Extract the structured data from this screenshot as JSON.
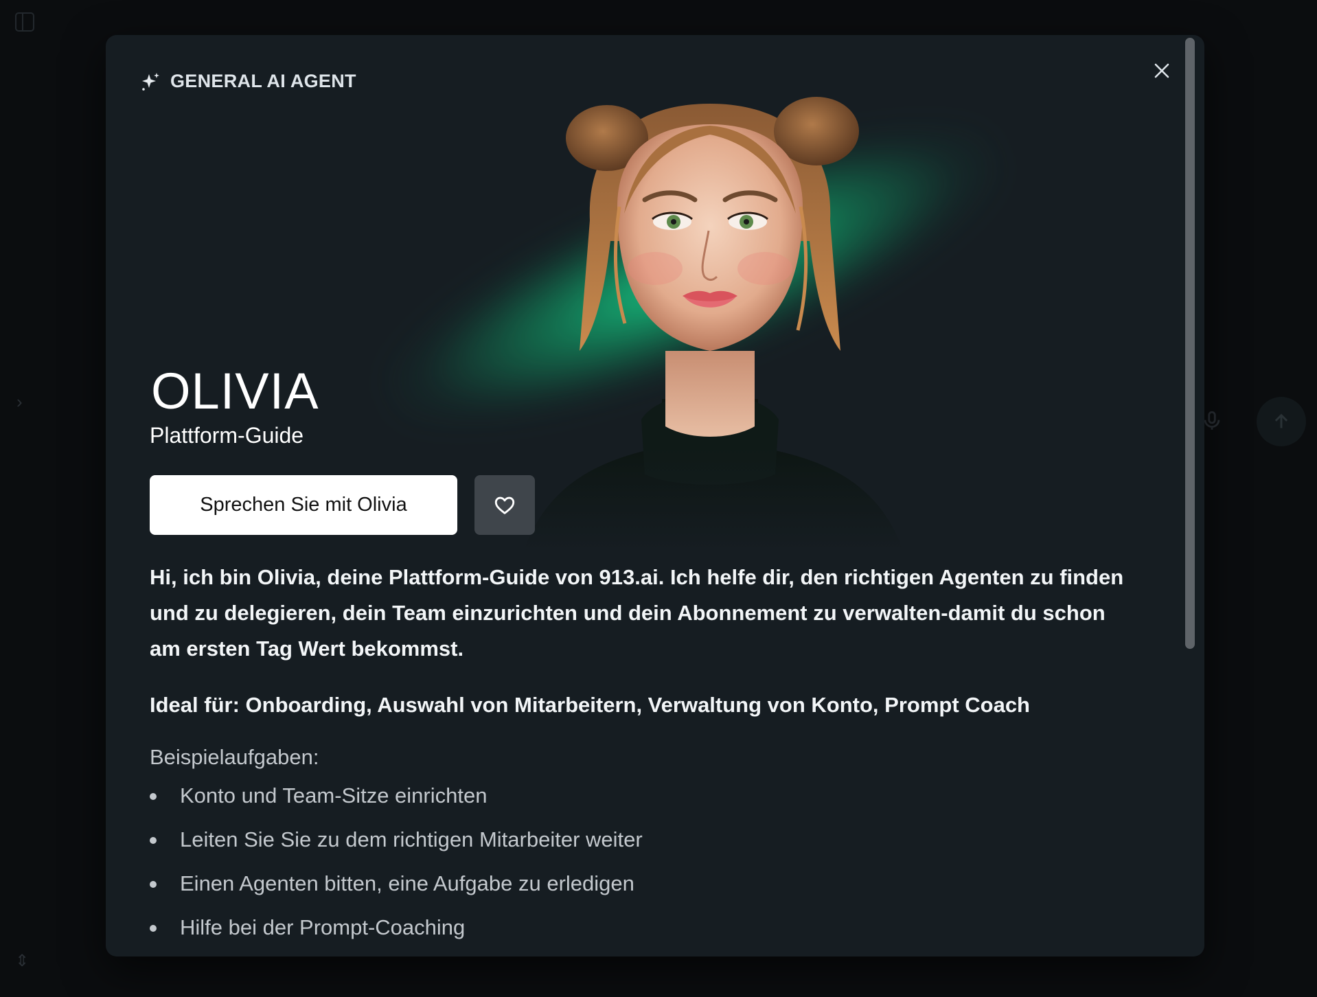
{
  "modal": {
    "agent_type": "GENERAL AI AGENT",
    "agent_name": "OLIVIA",
    "agent_role": "Plattform-Guide",
    "cta_label": "Sprechen Sie mit Olivia",
    "description": "Hi, ich bin Olivia, deine Plattform-Guide von 913.ai. Ich helfe dir, den richtigen Agenten zu finden und zu delegieren, dein Team einzurichten und dein Abonnement zu verwalten-damit du schon am ersten Tag Wert bekommst.",
    "ideal_for": "Ideal für: Onboarding, Auswahl von Mitarbeitern, Verwaltung von Konto, Prompt Coach",
    "examples_title": "Beispielaufgaben:",
    "examples": [
      "Konto und Team-Sitze einrichten",
      "Leiten Sie Sie zu dem richtigen Mitarbeiter weiter",
      "Einen Agenten bitten, eine Aufgabe zu erledigen",
      "Hilfe bei der Prompt-Coaching"
    ]
  },
  "icons": {
    "agent_type": "sparkle-icon",
    "close": "close-icon",
    "favorite": "heart-icon"
  },
  "colors": {
    "overlay": "#0b0d0f",
    "modal_bg": "#161d22",
    "accent_glow": "#18d48c",
    "cta_bg": "#ffffff",
    "favorite_bg": "#3f454b"
  }
}
